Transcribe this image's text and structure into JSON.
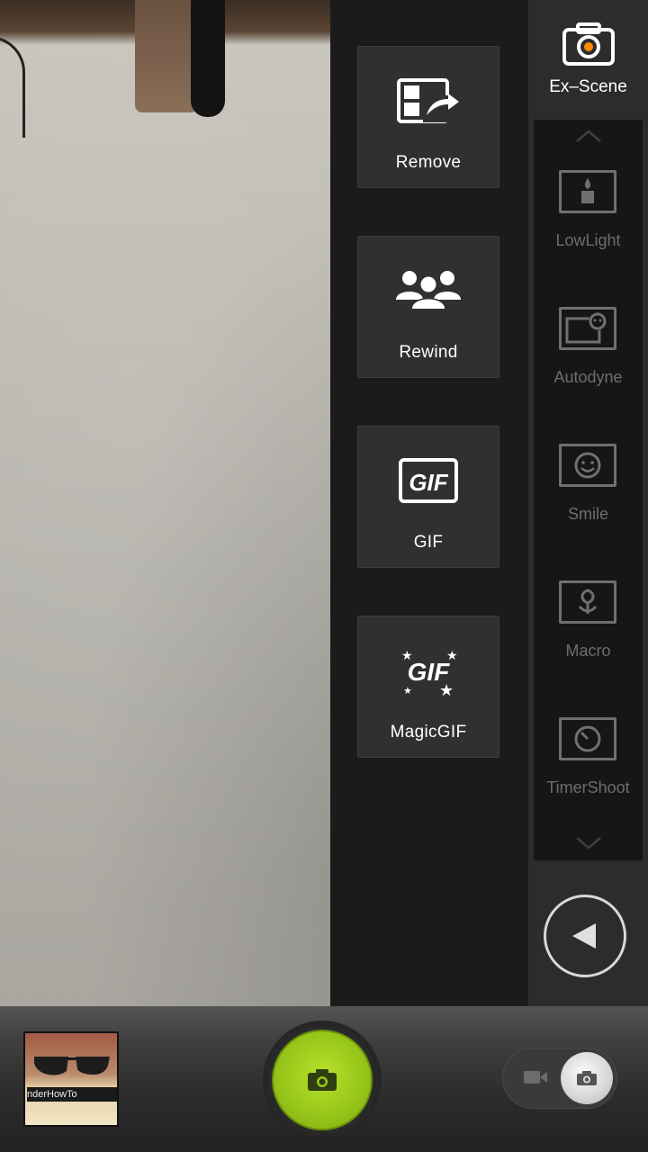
{
  "effects": [
    {
      "id": "remove",
      "label": "Remove",
      "icon": "remove-icon"
    },
    {
      "id": "rewind",
      "label": "Rewind",
      "icon": "group-faces-icon"
    },
    {
      "id": "gif",
      "label": "GIF",
      "icon": "gif-icon"
    },
    {
      "id": "magicgif",
      "label": "MagicGIF",
      "icon": "magic-gif-icon"
    }
  ],
  "scene_header": {
    "label": "Ex–Scene",
    "icon": "camera-scene-icon"
  },
  "scenes": [
    {
      "label": "LowLight",
      "icon": "candle-icon"
    },
    {
      "label": "Autodyne",
      "icon": "selfie-icon"
    },
    {
      "label": "Smile",
      "icon": "smile-face-icon"
    },
    {
      "label": "Macro",
      "icon": "flower-icon"
    },
    {
      "label": "TimerShoot",
      "icon": "timer-icon"
    }
  ],
  "icons": {
    "scroll_up": "chevron-up-icon",
    "scroll_down": "chevron-down-icon",
    "back": "back-triangle-icon",
    "shutter": "camera-icon",
    "video": "video-icon",
    "photo": "camera-icon"
  },
  "gif_text": "GIF",
  "gallery_thumbnail_text": "nderHowTo",
  "colors": {
    "accent_green": "#98c71b",
    "panel_bg": "#1b1b1b",
    "tile_bg": "#303030",
    "scene_text": "#6d6d6d"
  }
}
